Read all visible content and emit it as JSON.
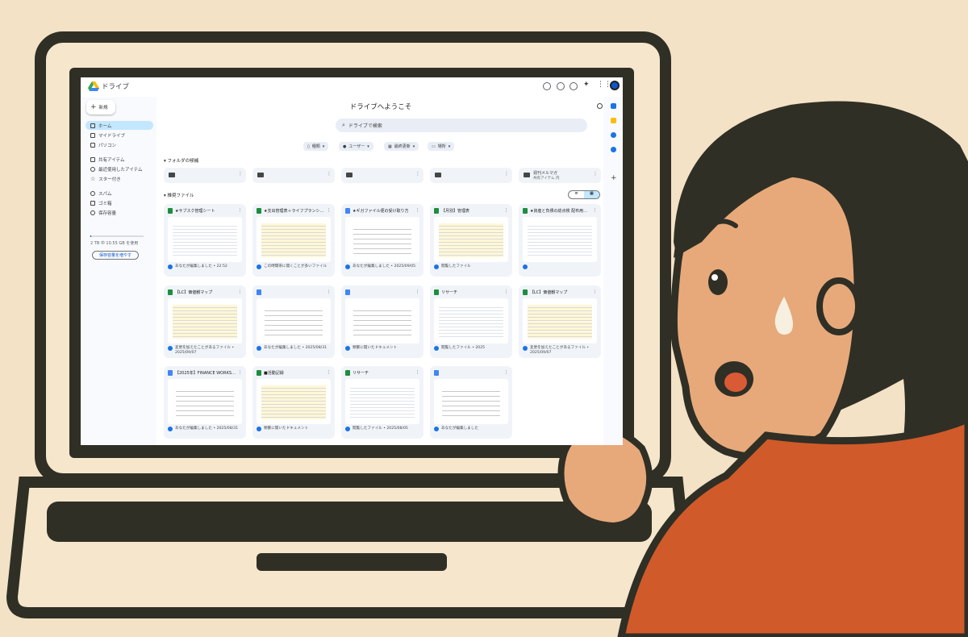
{
  "app": {
    "title": "ドライブ",
    "welcome": "ドライブへようこそ"
  },
  "sidebar": {
    "new_label": "新規",
    "items": [
      {
        "label": "ホーム"
      },
      {
        "label": "マイドライブ"
      },
      {
        "label": "パソコン"
      },
      {
        "label": "共有アイテム"
      },
      {
        "label": "最近使用したアイテム"
      },
      {
        "label": "スター付き"
      },
      {
        "label": "スパム"
      },
      {
        "label": "ゴミ箱"
      },
      {
        "label": "保存容量"
      }
    ],
    "storage_text": "2 TB 中 10.55 GB を使用",
    "storage_fraction": 0.005,
    "storage_button": "保存容量を増やす"
  },
  "search": {
    "placeholder": "ドライブで検索"
  },
  "filters": [
    "種類",
    "ユーザー",
    "最終更新",
    "場所"
  ],
  "sections": {
    "folders": "フォルダの候補",
    "files": "推奨ファイル"
  },
  "folders": [
    {
      "name": ""
    },
    {
      "name": ""
    },
    {
      "name": ""
    },
    {
      "name": ""
    },
    {
      "name": "週刊メルマガ",
      "sub": "共有アイテム 内"
    }
  ],
  "files": [
    {
      "title": "★サブスク管理シート",
      "meta": "あなたが編集しました • 22:52",
      "type": "sheet"
    },
    {
      "title": "★支出管理表＋ライフプランシ…",
      "meta": "この時間帯に開くことが多いファイル",
      "type": "sheet"
    },
    {
      "title": "★ギガファイル便の受け取り方",
      "meta": "あなたが編集しました • 2025/09/05",
      "type": "doc"
    },
    {
      "title": "【月別】管理表",
      "meta": "閲覧したファイル",
      "type": "sheet"
    },
    {
      "title": "★資産と負債の総点検 配布用…",
      "meta": "",
      "type": "sheet"
    },
    {
      "title": "【LC】価値観マップ",
      "meta": "変更を加えたことがあるファイル • 2025/09/07",
      "type": "sheet"
    },
    {
      "title": "",
      "meta": "あなたが編集しました • 2025/08/31",
      "type": "doc"
    },
    {
      "title": "",
      "meta": "頻繁に開いたドキュメント",
      "type": "doc"
    },
    {
      "title": "リサーチ",
      "meta": "閲覧したファイル • 2025",
      "type": "sheet"
    },
    {
      "title": "【LC】価値観マップ",
      "meta": "変更を加えたことがあるファイル • 2025/09/07",
      "type": "sheet"
    },
    {
      "title": "【2025年】FINANCE WORKS…",
      "meta": "あなたが編集しました • 2025/08/31",
      "type": "doc"
    },
    {
      "title": "■活動記録",
      "meta": "頻繁に開いたドキュメント",
      "type": "sheet"
    },
    {
      "title": "リサーチ",
      "meta": "閲覧したファイル • 2025/08/05",
      "type": "sheet"
    },
    {
      "title": "",
      "meta": "あなたが編集しました",
      "type": "doc"
    }
  ],
  "colors": {
    "sheet": "#1e8e3e",
    "doc": "#4285f4",
    "accent": "#0b57d0",
    "background": "#f3e2c6",
    "sweater": "#d05a2a"
  }
}
